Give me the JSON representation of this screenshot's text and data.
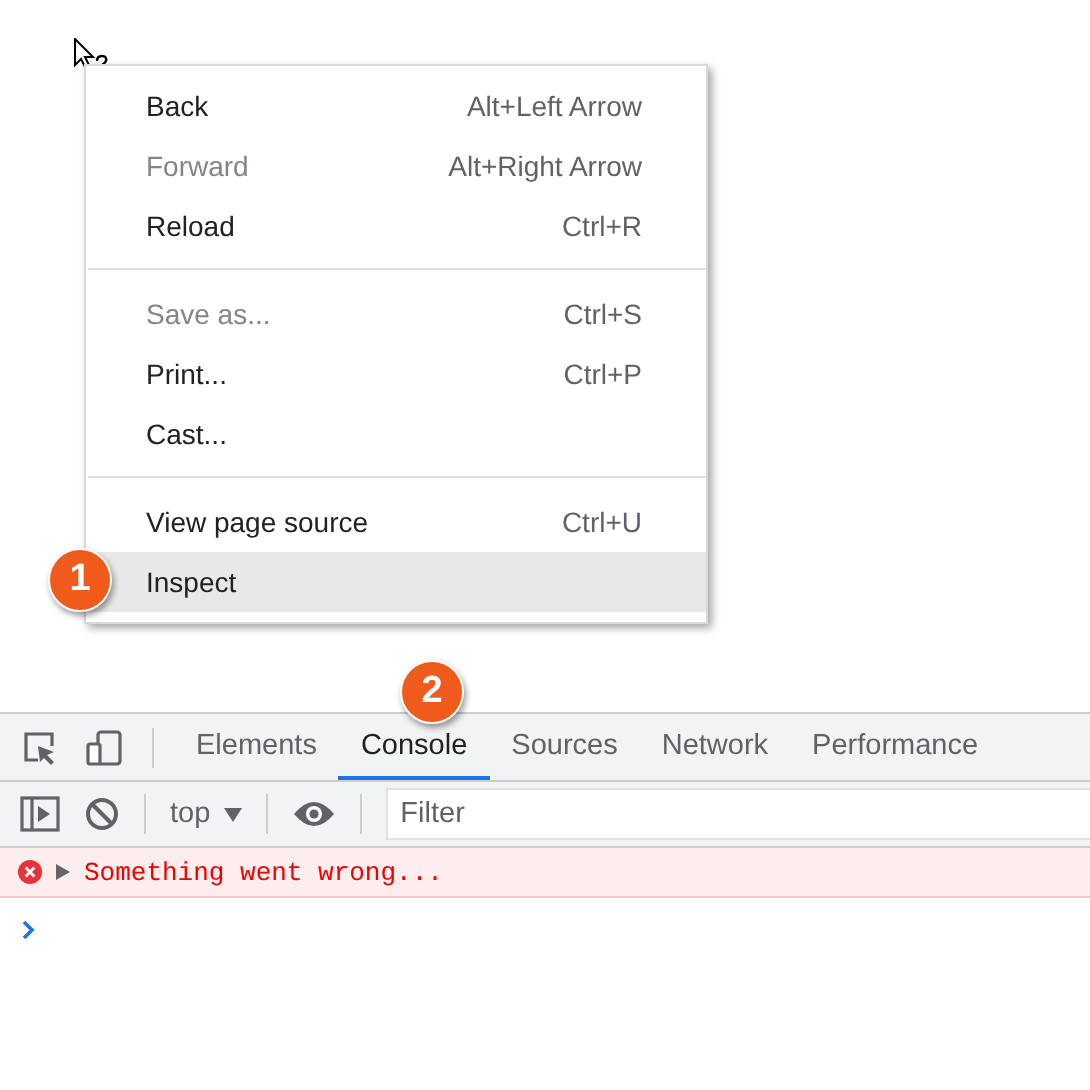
{
  "context_menu": {
    "groups": [
      [
        {
          "label": "Back",
          "shortcut": "Alt+Left Arrow",
          "disabled": false,
          "selected": false
        },
        {
          "label": "Forward",
          "shortcut": "Alt+Right Arrow",
          "disabled": true,
          "selected": false
        },
        {
          "label": "Reload",
          "shortcut": "Ctrl+R",
          "disabled": false,
          "selected": false
        }
      ],
      [
        {
          "label": "Save as...",
          "shortcut": "Ctrl+S",
          "disabled": true,
          "selected": false
        },
        {
          "label": "Print...",
          "shortcut": "Ctrl+P",
          "disabled": false,
          "selected": false
        },
        {
          "label": "Cast...",
          "disabled": false,
          "selected": false
        }
      ],
      [
        {
          "label": "View page source",
          "shortcut": "Ctrl+U",
          "disabled": false,
          "selected": false
        },
        {
          "label": "Inspect",
          "disabled": false,
          "selected": true,
          "callout": "1"
        }
      ]
    ]
  },
  "devtools": {
    "tabs": [
      {
        "label": "Elements",
        "selected": false
      },
      {
        "label": "Console",
        "selected": true,
        "callout": "2"
      },
      {
        "label": "Sources",
        "selected": false
      },
      {
        "label": "Network",
        "selected": false
      },
      {
        "label": "Performance",
        "selected": false
      }
    ],
    "context": "top",
    "filter": {
      "placeholder": "Filter"
    },
    "messages": [
      {
        "kind": "error",
        "text": "Something went wrong..."
      }
    ]
  }
}
